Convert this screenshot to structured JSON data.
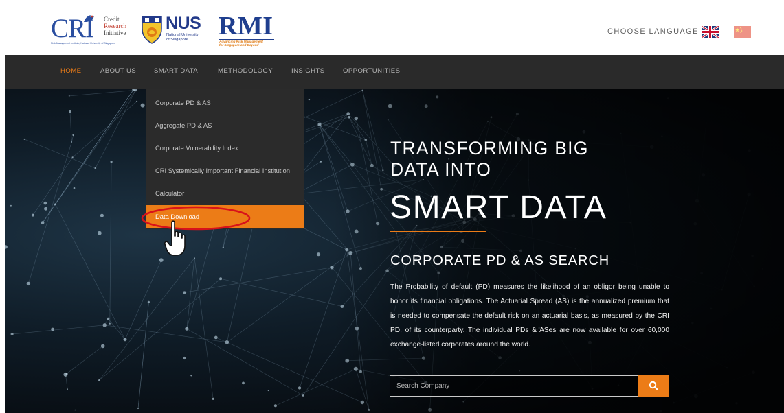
{
  "header": {
    "cri_logo": {
      "letters": "CRI",
      "words": [
        "Credit",
        "Research",
        "Initiative"
      ],
      "tagline": "Risk Management Institute, National University of Singapore"
    },
    "nus_logo": {
      "text": "NUS",
      "subtitle_line1": "National University",
      "subtitle_line2": "of Singapore"
    },
    "rmi_logo": {
      "text": "RMI",
      "subtitle_line1": "Advancing Risk Management",
      "subtitle_line2": "for Singapore and Beyond"
    },
    "language_label": "CHOOSE LANGUAGE",
    "flags": [
      "uk-flag-icon",
      "china-flag-icon"
    ]
  },
  "nav": {
    "items": [
      "HOME",
      "ABOUT US",
      "SMART DATA",
      "METHODOLOGY",
      "INSIGHTS",
      "OPPORTUNITIES"
    ],
    "active": "HOME"
  },
  "dropdown": {
    "items": [
      "Corporate PD & AS",
      "Aggregate PD & AS",
      "Corporate Vulnerability Index",
      "CRI Systemically Important Financial Institution",
      "Calculator",
      "Data Download"
    ],
    "highlighted": "Data Download"
  },
  "hero": {
    "title_line1": "TRANSFORMING BIG",
    "title_line2": "DATA INTO",
    "title_big": "SMART DATA",
    "section_title": "CORPORATE PD & AS SEARCH",
    "body": "The Probability of default (PD) measures the likelihood of an obligor being unable to honor its financial obligations. The Actuarial Spread (AS) is the annualized premium that is needed to compensate the default risk on an actuarial basis, as measured by the CRI PD, of its counterparty. The individual PDs & ASes are now available for over 60,000 exchange-listed corporates around the world.",
    "search_placeholder": "Search Company",
    "search_icon": "search-icon"
  },
  "colors": {
    "accent": "#ec7c17",
    "nav_bg": "#2a2a2a",
    "dropdown_bg": "#2b2b2b",
    "annotation": "#d8121a",
    "logo_blue": "#233a8a"
  }
}
